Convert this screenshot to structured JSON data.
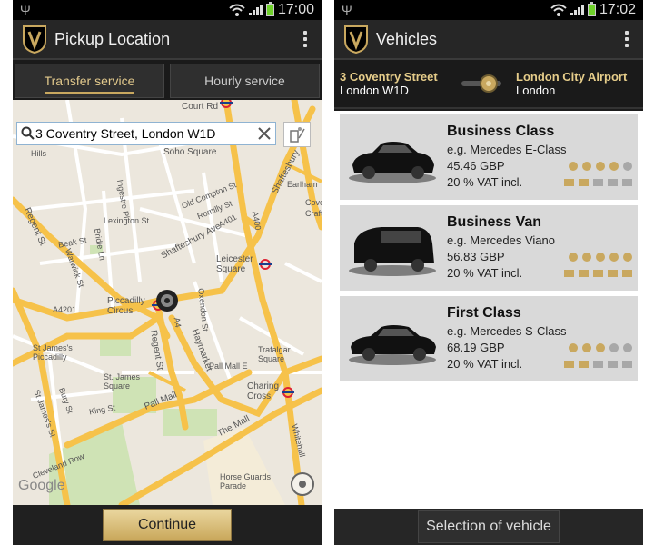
{
  "left": {
    "status_time": "17:00",
    "title": "Pickup Location",
    "tabs": [
      "Transfer service",
      "Hourly service"
    ],
    "active_tab": 0,
    "search_value": "3 Coventry Street, London W1D",
    "continue_label": "Continue",
    "map_labels": [
      "Court Rd",
      "Soho Square",
      "Shaftesbury",
      "Hills",
      "Regent St",
      "Ingestre Pl",
      "Lexington St",
      "Beak St",
      "Warwick St",
      "Bridle Ln",
      "Old Compton St",
      "Romilly St",
      "A401",
      "Shaftesbury Ave",
      "A400",
      "Leicester Square",
      "Piccadilly Circus",
      "A4201",
      "A4",
      "Haymarket",
      "Oxendon St",
      "Regent St",
      "St James's Piccadilly",
      "Trafalgar Square",
      "St. James Square",
      "Pall Mall",
      "Charing Cross",
      "King St",
      "Bury St",
      "St James's St",
      "The Mall",
      "Whitehall",
      "Horse Guards Parade",
      "Cleveland Row",
      "Google",
      "Earlham",
      "Cove",
      "Craft",
      "Pall Mall E"
    ]
  },
  "right": {
    "status_time": "17:02",
    "title": "Vehicles",
    "from_line1": "3 Coventry Street",
    "from_line2": "London W1D",
    "to_line1": "London City Airport",
    "to_line2": "London",
    "vehicles": [
      {
        "name": "Business Class",
        "example": "e.g. Mercedes E-Class",
        "price": "45.46 GBP",
        "vat": "20 % VAT incl.",
        "passengers": 4,
        "luggage": 2
      },
      {
        "name": "Business Van",
        "example": "e.g. Mercedes Viano",
        "price": "56.83 GBP",
        "vat": "20 % VAT incl.",
        "passengers": 5,
        "luggage": 5
      },
      {
        "name": "First Class",
        "example": "e.g. Mercedes S-Class",
        "price": "68.19 GBP",
        "vat": "20 % VAT incl.",
        "passengers": 3,
        "luggage": 2
      }
    ],
    "select_label": "Selection of vehicle"
  },
  "colors": {
    "accent": "#c9a85f",
    "bar": "#262626"
  },
  "icons": [
    "usb-icon",
    "wifi-icon",
    "signal-icon",
    "battery-icon",
    "app-logo-icon",
    "overflow-menu-icon",
    "search-icon",
    "clear-icon",
    "location-button-icon",
    "tube-icon",
    "pin-icon",
    "route-knob-icon",
    "car-icon",
    "passenger-icon",
    "luggage-icon"
  ]
}
